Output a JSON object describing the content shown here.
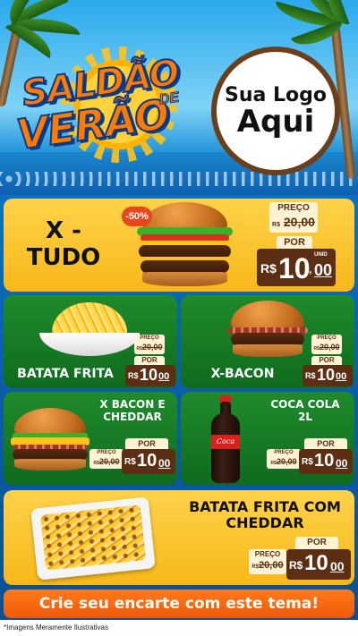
{
  "header": {
    "title_line1": "SALDÃO",
    "title_de": "DE",
    "title_line2": "VERÃO",
    "logo_line1": "Sua Logo",
    "logo_line2": "Aqui"
  },
  "labels": {
    "preco": "PREÇO",
    "por": "POR",
    "currency": "R$",
    "unid": "UNID"
  },
  "products": [
    {
      "name_l1": "X -",
      "name_l2": "TUDO",
      "discount": "-50%",
      "old_price": "20,00",
      "price_int": "10",
      "price_cents": "00"
    },
    {
      "name": "BATATA FRITA",
      "old_price": "20,00",
      "price_int": "10",
      "price_cents": "00"
    },
    {
      "name": "X-BACON",
      "old_price": "20,00",
      "price_int": "10",
      "price_cents": "00"
    },
    {
      "name_l1": "X BACON E",
      "name_l2": "CHEDDAR",
      "old_price": "20,00",
      "price_int": "10",
      "price_cents": "00"
    },
    {
      "name_l1": "COCA COLA",
      "name_l2": "2L",
      "old_price": "20,00",
      "price_int": "10",
      "price_cents": "00"
    },
    {
      "name_l1": "BATATA FRITA COM",
      "name_l2": "CHEDDAR",
      "old_price": "20,00",
      "price_int": "10",
      "price_cents": "00"
    }
  ],
  "cta": "Crie seu encarte com este tema!",
  "footer_note": "*Imagens Meramente Ilustrativas",
  "colors": {
    "yellow_card": "#f7b81a",
    "green_card": "#0f6b1d",
    "price_tag": "#5c2f14",
    "cta": "#f05a0a",
    "title": "#ff7a00"
  }
}
